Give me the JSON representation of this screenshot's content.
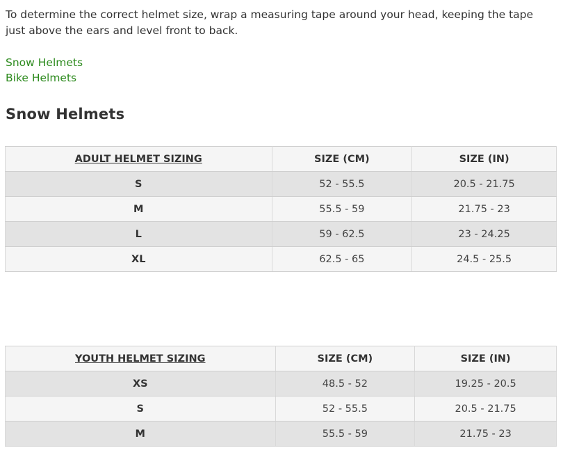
{
  "intro": {
    "text": "To determine the correct helmet size, wrap a measuring tape around your head, keeping the tape just above the ears and level front to back."
  },
  "links": {
    "snow": "Snow Helmets",
    "bike": "Bike Helmets"
  },
  "section": {
    "title": "Snow Helmets"
  },
  "adult_table": {
    "headers": [
      "ADULT HELMET SIZING",
      "SIZE (CM)",
      "SIZE (IN)"
    ],
    "rows": [
      {
        "size": "S",
        "cm": "52 - 55.5",
        "in": "20.5 - 21.75"
      },
      {
        "size": "M",
        "cm": "55.5 - 59",
        "in": "21.75 - 23"
      },
      {
        "size": "L",
        "cm": "59 - 62.5",
        "in": "23 - 24.25"
      },
      {
        "size": "XL",
        "cm": "62.5 - 65",
        "in": "24.5 - 25.5"
      }
    ]
  },
  "youth_table": {
    "headers": [
      "YOUTH HELMET SIZING",
      "SIZE (CM)",
      "SIZE (IN)"
    ],
    "rows": [
      {
        "size": "XS",
        "cm": "48.5 - 52",
        "in": "19.25 - 20.5"
      },
      {
        "size": "S",
        "cm": "52 - 55.5",
        "in": "20.5 - 21.75"
      },
      {
        "size": "M",
        "cm": "55.5 - 59",
        "in": "21.75 - 23"
      }
    ]
  },
  "colors": {
    "link": "#2e8b1f",
    "text": "#333333",
    "row_shaded": "#e3e3e3",
    "row_light": "#f5f5f5"
  }
}
